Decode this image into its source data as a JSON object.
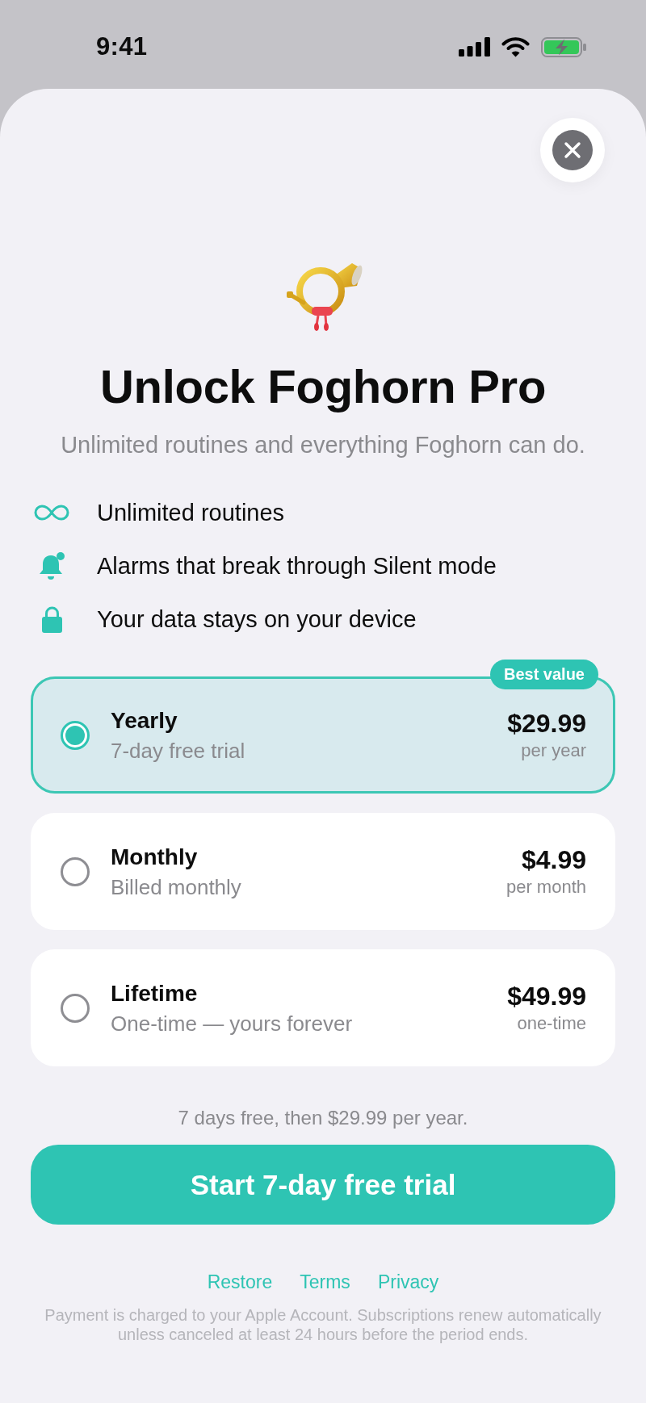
{
  "status_bar": {
    "time": "9:41"
  },
  "header": {
    "title": "Unlock Foghorn Pro",
    "subtitle": "Unlimited routines and everything Foghorn can do."
  },
  "features": [
    "Unlimited routines",
    "Alarms that break through Silent mode",
    "Your data stays on your device"
  ],
  "plans": [
    {
      "name": "Yearly",
      "detail": "7-day free trial",
      "price": "$29.99",
      "period": "per year",
      "badge": "Best value",
      "selected": true
    },
    {
      "name": "Monthly",
      "detail": "Billed monthly",
      "price": "$4.99",
      "period": "per month",
      "selected": false
    },
    {
      "name": "Lifetime",
      "detail": "One-time — yours forever",
      "price": "$49.99",
      "period": "one-time",
      "selected": false
    }
  ],
  "trial_note": "7 days free, then $29.99 per year.",
  "cta_button": "Start 7-day free trial",
  "links": [
    "Restore",
    "Terms",
    "Privacy"
  ],
  "legal": "Payment is charged to your Apple Account. Subscriptions renew automatically unless canceled at least 24 hours before the period ends."
}
